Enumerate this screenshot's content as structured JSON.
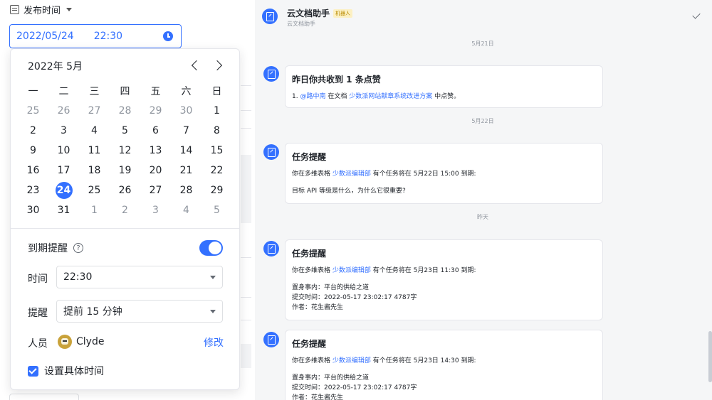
{
  "left": {
    "field_label": "发布时间",
    "date_value": "2022/05/24",
    "time_value": "22:30"
  },
  "calendar": {
    "header": "2022年 5月",
    "weekdays": [
      "一",
      "二",
      "三",
      "四",
      "五",
      "六",
      "日"
    ],
    "days": [
      {
        "d": "25",
        "m": true
      },
      {
        "d": "26",
        "m": true
      },
      {
        "d": "27",
        "m": true
      },
      {
        "d": "28",
        "m": true
      },
      {
        "d": "29",
        "m": true
      },
      {
        "d": "30",
        "m": true
      },
      {
        "d": "1"
      },
      {
        "d": "2"
      },
      {
        "d": "3"
      },
      {
        "d": "4"
      },
      {
        "d": "5"
      },
      {
        "d": "6"
      },
      {
        "d": "7"
      },
      {
        "d": "8"
      },
      {
        "d": "9"
      },
      {
        "d": "10"
      },
      {
        "d": "11"
      },
      {
        "d": "12"
      },
      {
        "d": "13"
      },
      {
        "d": "14"
      },
      {
        "d": "15"
      },
      {
        "d": "16"
      },
      {
        "d": "17"
      },
      {
        "d": "18"
      },
      {
        "d": "19"
      },
      {
        "d": "20"
      },
      {
        "d": "21"
      },
      {
        "d": "22"
      },
      {
        "d": "23"
      },
      {
        "d": "24",
        "s": true
      },
      {
        "d": "25"
      },
      {
        "d": "26"
      },
      {
        "d": "27"
      },
      {
        "d": "28"
      },
      {
        "d": "29"
      },
      {
        "d": "30"
      },
      {
        "d": "31"
      },
      {
        "d": "1",
        "m": true
      },
      {
        "d": "2",
        "m": true
      },
      {
        "d": "3",
        "m": true
      },
      {
        "d": "4",
        "m": true
      },
      {
        "d": "5",
        "m": true
      }
    ],
    "reminder_label": "到期提醒",
    "reminder_on": true,
    "time_label": "时间",
    "time_select": "22:30",
    "remind_label": "提醒",
    "remind_select": "提前 15 分钟",
    "person_label": "人员",
    "person_name": "Clyde",
    "edit_label": "修改",
    "specific_time_label": "设置具体时间",
    "specific_time_checked": true
  },
  "chat": {
    "bot_name": "云文档助手",
    "bot_badge": "机器人",
    "bot_sub": "云文档助手",
    "date_sep_1": "5月21日",
    "date_sep_2": "5月22日",
    "date_sep_3": "昨天",
    "msg1": {
      "title": "昨日你共收到 1 条点赞",
      "prefix": "1. ",
      "user": "@路中南",
      "mid": " 在文档 ",
      "doc": "少数派网站献章系统改进方案",
      "suffix": " 中点赞。"
    },
    "msg2": {
      "title": "任务提醒",
      "pre": "你在多维表格 ",
      "table": "少数派编辑部",
      "post": " 有个任务将在 5月22日 15:00 到期:",
      "body": "目标 API 等级是什么，为什么它很重要?"
    },
    "msg3": {
      "title": "任务提醒",
      "pre": "你在多维表格 ",
      "table": "少数派编辑部",
      "post": " 有个任务将在 5月23日 11:30 到期:",
      "l1": "置身事内：平台的供给之道",
      "l2": "提交时间：2022-05-17 23:02:17  4787字",
      "l3": "作者：花生酱先生"
    },
    "msg4": {
      "title": "任务提醒",
      "pre": "你在多维表格 ",
      "table": "少数派编辑部",
      "post": " 有个任务将在 5月23日 14:30 到期:",
      "l1": "置身事内：平台的供给之道",
      "l2": "提交时间：2022-05-17 23:02:17  4787字",
      "l3": "作者：花生酱先生"
    }
  },
  "colors": {
    "accent": "#3370ff",
    "chat_bg": "#f5f6f7"
  }
}
